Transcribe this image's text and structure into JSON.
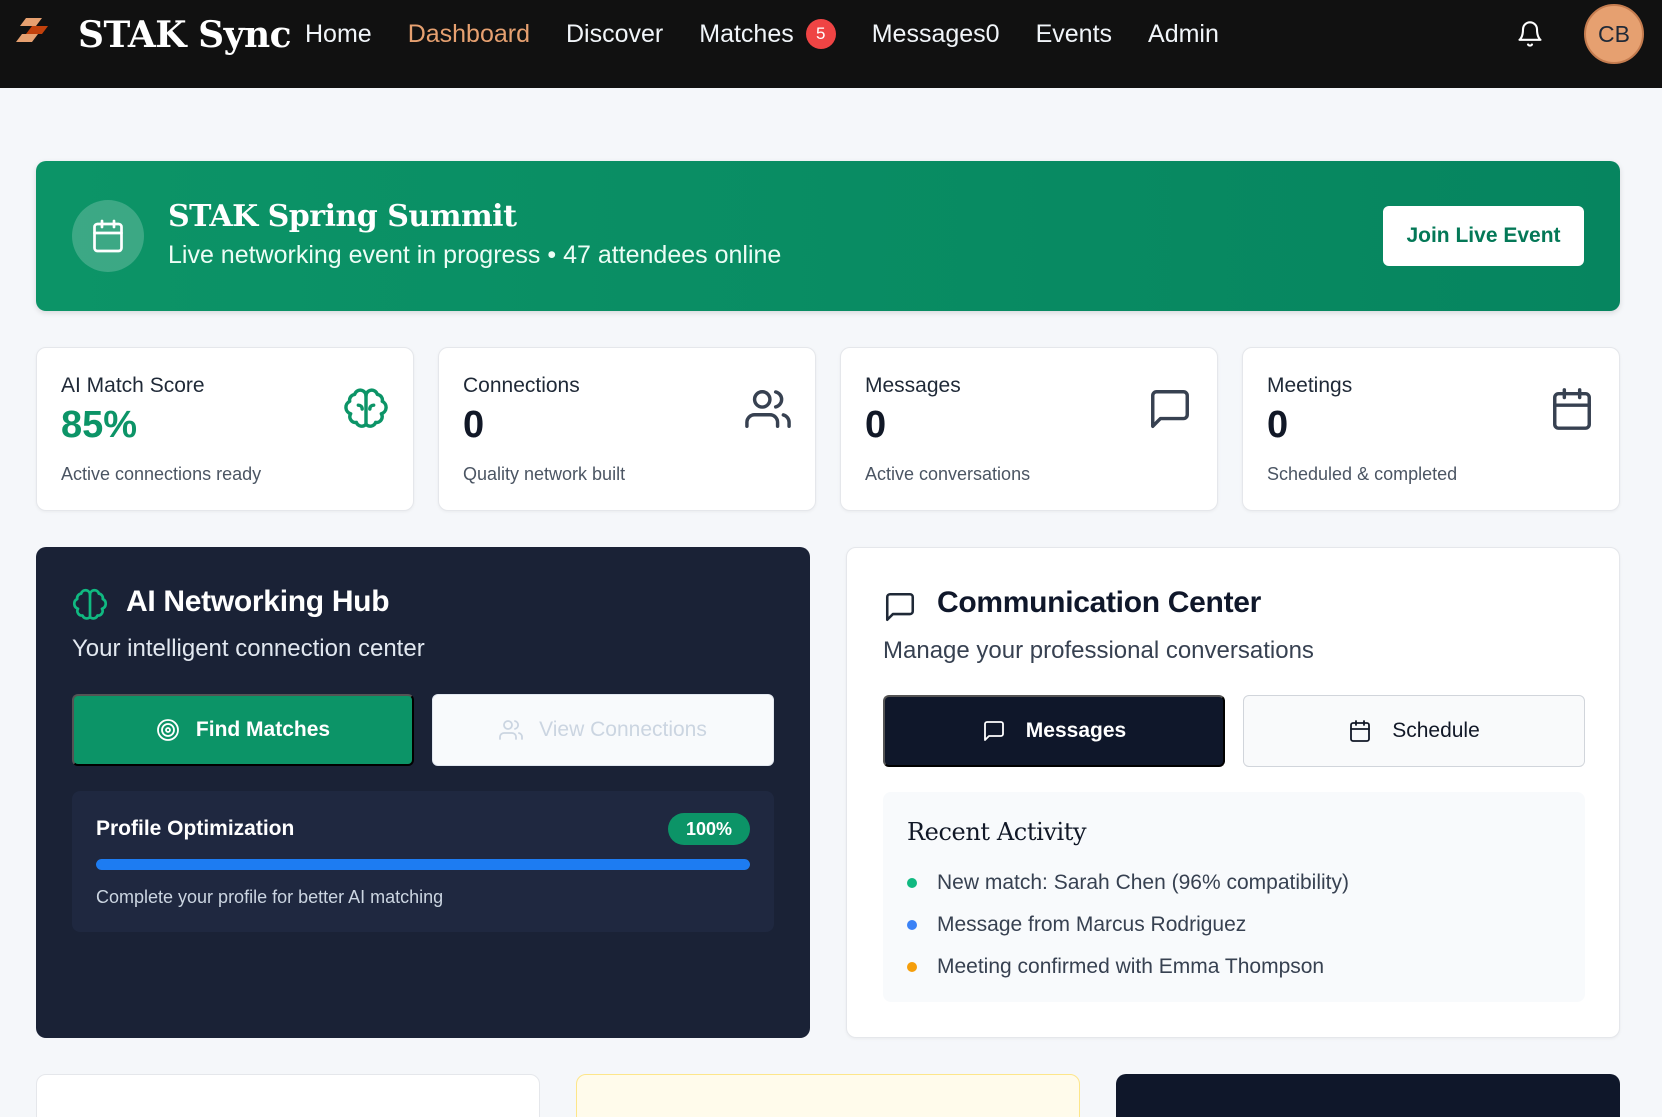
{
  "nav": {
    "brand": "STAK Sync",
    "links": [
      {
        "label": "Home"
      },
      {
        "label": "Dashboard"
      },
      {
        "label": "Discover"
      },
      {
        "label": "Matches",
        "badge": "5"
      },
      {
        "label": "Messages0"
      },
      {
        "label": "Events"
      },
      {
        "label": "Admin"
      }
    ],
    "active_link": "Dashboard",
    "avatar_initials": "CB",
    "icons": {
      "logo": "stak-logo-icon",
      "notifications": "bell-icon"
    }
  },
  "event_banner": {
    "title": "STAK Spring Summit",
    "subtitle": "Live networking event in progress • 47 attendees online",
    "button_label": "Join Live Event",
    "icon": "calendar-icon"
  },
  "stats": [
    {
      "label": "AI Match Score",
      "value": "85%",
      "sub": "Active connections ready",
      "icon": "brain-icon"
    },
    {
      "label": "Connections",
      "value": "0",
      "sub": "Quality network built",
      "icon": "users-icon"
    },
    {
      "label": "Messages",
      "value": "0",
      "sub": "Active conversations",
      "icon": "message-icon"
    },
    {
      "label": "Meetings",
      "value": "0",
      "sub": "Scheduled & completed",
      "icon": "calendar-icon"
    }
  ],
  "ai_hub": {
    "title": "AI Networking Hub",
    "subtitle": "Your intelligent connection center",
    "find_button": "Find Matches",
    "view_button": "View Connections",
    "profile": {
      "title": "Profile Optimization",
      "percent_label": "100%",
      "progress": 1.0,
      "note": "Complete your profile for better AI matching"
    }
  },
  "comm_center": {
    "title": "Communication Center",
    "subtitle": "Manage your professional conversations",
    "messages_button": "Messages",
    "schedule_button": "Schedule",
    "activity_title": "Recent Activity",
    "activity": [
      {
        "text": "New match: Sarah Chen (96% compatibility)",
        "color": "#10b981"
      },
      {
        "text": "Message from Marcus Rodriguez",
        "color": "#3b82f6"
      },
      {
        "text": "Meeting confirmed with Emma Thompson",
        "color": "#f59e0b"
      }
    ]
  },
  "colors": {
    "accent_green": "#0c9467",
    "nav_active": "#e6a070",
    "hub_bg": "#1a2236",
    "badge_red": "#ef4444"
  }
}
